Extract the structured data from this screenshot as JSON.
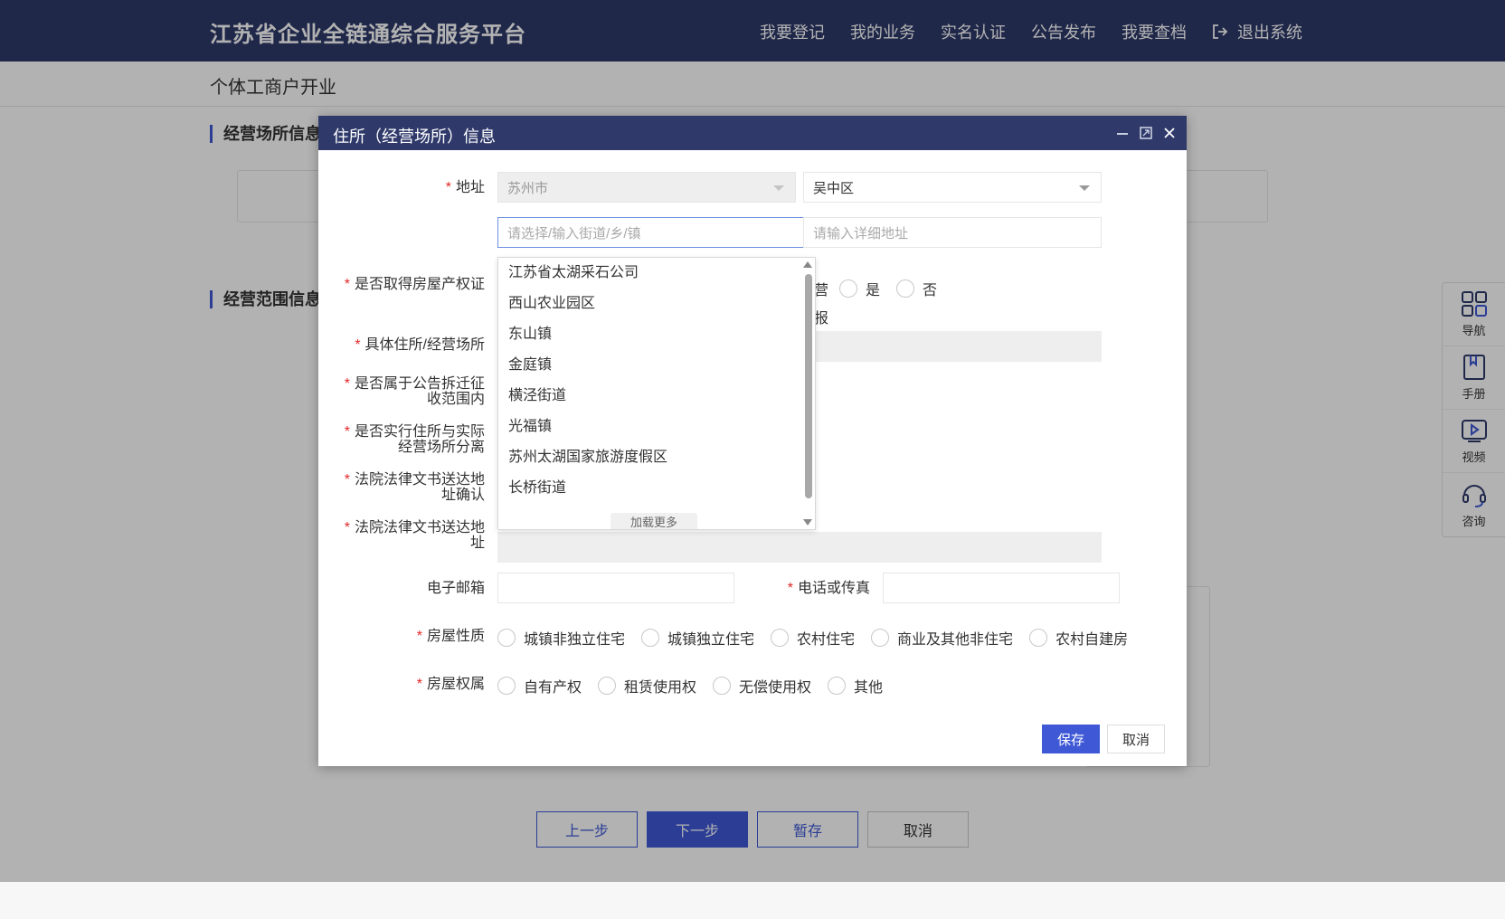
{
  "header": {
    "brand": "江苏省企业全链通综合服务平台",
    "nav": [
      "我要登记",
      "我的业务",
      "实名认证",
      "公告发布",
      "我要查档"
    ],
    "logout_label": "退出系统"
  },
  "subheader": {
    "title": "个体工商户开业"
  },
  "sections": {
    "place_title": "经营场所信息",
    "scope_title": "经营范围信息"
  },
  "bottom_buttons": {
    "prev": "上一步",
    "next": "下一步",
    "draft": "暂存",
    "cancel": "取消"
  },
  "side_panel": [
    {
      "label": "导航",
      "icon": "grid-icon"
    },
    {
      "label": "手册",
      "icon": "book-icon"
    },
    {
      "label": "视频",
      "icon": "video-icon"
    },
    {
      "label": "咨询",
      "icon": "headset-icon"
    }
  ],
  "modal": {
    "title": "住所（经营场所）信息",
    "address": {
      "label": "地址",
      "city": "苏州市",
      "district": "吴中区",
      "street_placeholder": "请选择/输入街道/乡/镇",
      "detail_placeholder": "请输入详细地址"
    },
    "dropdown": {
      "options": [
        "江苏省太湖采石公司",
        "西山农业园区",
        "东山镇",
        "金庭镇",
        "横泾街道",
        "光福镇",
        "苏州太湖国家旅游度假区",
        "长桥街道"
      ],
      "load_more": "加载更多"
    },
    "labels": {
      "house_cert": "是否取得房屋产权证",
      "specific_place": "具体住所/经营场所",
      "demolition_1": "是否属于公告拆迁征",
      "demolition_2": "收范围内",
      "separation_1": "是否实行住所与实际",
      "separation_2": "经营场所分离",
      "court_confirm_1": "法院法律文书送达地",
      "court_confirm_2": "址确认",
      "court_addr_1": "法院法律文书送达地",
      "court_addr_2": "址",
      "email": "电子邮箱",
      "phone": "电话或传真",
      "house_type": "房屋性质",
      "house_right": "房屋权属"
    },
    "partial_texts": {
      "ying": "营",
      "bao": "报"
    },
    "yes_no": [
      "是",
      "否"
    ],
    "house_type_options": [
      "城镇非独立住宅",
      "城镇独立住宅",
      "农村住宅",
      "商业及其他非住宅",
      "农村自建房"
    ],
    "house_right_options": [
      "自有产权",
      "租赁使用权",
      "无偿使用权",
      "其他"
    ],
    "buttons": {
      "save": "保存",
      "cancel": "取消"
    }
  }
}
